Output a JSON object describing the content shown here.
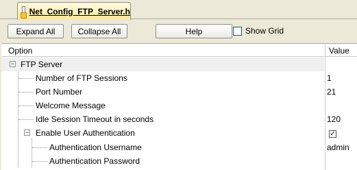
{
  "tab": {
    "title": "Net_Config_FTP_Server.h",
    "icon": "header-file-icon"
  },
  "toolbar": {
    "expand_all": "Expand All",
    "collapse_all": "Collapse All",
    "help": "Help",
    "show_grid_label": "Show Grid",
    "show_grid_checked": false
  },
  "grid": {
    "columns": {
      "option": "Option",
      "value": "Value"
    },
    "rows": [
      {
        "label": "FTP Server",
        "value": "",
        "expander": "−"
      },
      {
        "label": "Number of FTP Sessions",
        "value": "1"
      },
      {
        "label": "Port Number",
        "value": "21"
      },
      {
        "label": "Welcome Message",
        "value": ""
      },
      {
        "label": "Idle Session Timeout in seconds",
        "value": "120"
      },
      {
        "label": "Enable User Authentication",
        "value_checked": true,
        "expander": "−"
      },
      {
        "label": "Authentication Username",
        "value": "admin"
      },
      {
        "label": "Authentication Password",
        "value": ""
      }
    ]
  }
}
